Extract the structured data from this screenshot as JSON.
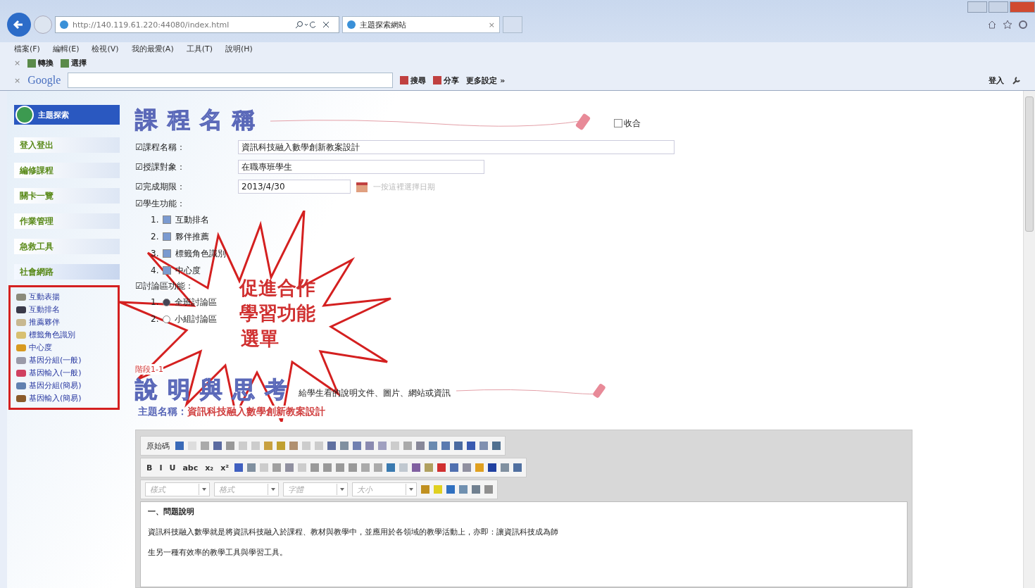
{
  "browser": {
    "address": "http://140.119.61.220:44080/index.html",
    "tabs": [
      {
        "label": "主題探索網站",
        "selected": true,
        "close": "×"
      }
    ],
    "toolbar_close": "×",
    "menu": [
      "檔案(F)",
      "編輯(E)",
      "檢視(V)",
      "我的最愛(A)",
      "工具(T)",
      "說明(H)"
    ],
    "favorites": [
      "轉換",
      "選擇"
    ],
    "google_bar": {
      "logo": "Google",
      "buttons": [
        "搜尋",
        "分享"
      ],
      "more": "更多設定 »",
      "sign_in": "登入"
    }
  },
  "sidebar": {
    "logo": "主題探索",
    "items": [
      {
        "label": "登入登出",
        "expanded": false
      },
      {
        "label": "編修課程",
        "expanded": false
      },
      {
        "label": "關卡一覽",
        "expanded": false
      },
      {
        "label": "作業管理",
        "expanded": false
      },
      {
        "label": "急救工具",
        "expanded": false
      },
      {
        "label": "社會網路",
        "expanded": true
      }
    ],
    "submenu": [
      {
        "label": "互動表揚",
        "color": "#8a8a7a"
      },
      {
        "label": "互動排名",
        "color": "#3a3a4a"
      },
      {
        "label": "推薦夥伴",
        "color": "#c8b890"
      },
      {
        "label": "標籤角色識別",
        "color": "#d8c070"
      },
      {
        "label": "中心度",
        "color": "#d89a20"
      },
      {
        "label": "基因分組(一般)",
        "color": "#9a9aa8"
      },
      {
        "label": "基因輸入(一般)",
        "color": "#d04060"
      },
      {
        "label": "基因分組(簡易)",
        "color": "#6080b0"
      },
      {
        "label": "基因輸入(簡易)",
        "color": "#8a5a2a"
      }
    ]
  },
  "course": {
    "title": "課程名稱",
    "collapse": {
      "label": "收合",
      "checked": false
    },
    "fields": [
      {
        "label": "☑課程名稱：",
        "value": "資訊科技融入數學創新教案設計",
        "kind": "long"
      },
      {
        "label": "☑授課對象：",
        "value": "在職專班學生",
        "kind": "medium"
      },
      {
        "label": "☑完成期限：",
        "value": "2013/4/30",
        "kind": "date",
        "hint": "一按這裡選擇日期"
      }
    ],
    "student_functions": {
      "label": "☑學生功能：",
      "items": [
        {
          "number": "1.",
          "label": "互動排名",
          "checked": true
        },
        {
          "number": "2.",
          "label": "夥伴推薦",
          "checked": true
        },
        {
          "number": "3.",
          "label": "標籤角色識別",
          "checked": true
        },
        {
          "number": "4.",
          "label": "中心度",
          "checked": true
        }
      ]
    },
    "discussion": {
      "label": "☑討論區功能：",
      "items": [
        {
          "number": "1.",
          "label": "全班討論區",
          "selected": true
        },
        {
          "number": "2.",
          "label": "小組討論區",
          "selected": false
        }
      ]
    }
  },
  "callout": [
    "促進合作",
    "學習功能",
    "選單"
  ],
  "stage": {
    "label": "階段1-1",
    "title": "說明與思考",
    "subtitle": "給學生看的說明文件、圖片、網站或資訊",
    "topic_label": "主題名稱：",
    "topic": "資訊科技融入數學創新教案設計"
  },
  "editor": {
    "source_button": "原始碼",
    "format_row": [
      {
        "kind": "glyph",
        "text": "B"
      },
      {
        "kind": "glyph",
        "text": "I"
      },
      {
        "kind": "glyph",
        "text": "U"
      },
      {
        "kind": "glyph",
        "text": "abc"
      },
      {
        "kind": "glyph",
        "text": "x₂"
      },
      {
        "kind": "glyph",
        "text": "x²"
      }
    ],
    "dropdowns": [
      "樣式",
      "格式",
      "字體",
      "大小"
    ],
    "content": [
      {
        "text": "一、問題說明",
        "kind": "heading"
      },
      {
        "text": "資訊科技融入數學就是將資訊科技融入於課程、教材與教學中，並應用於各領域的教學活動上，亦即：讓資訊科技成為師",
        "kind": "para"
      },
      {
        "text": "生另一種有效率的教學工具與學習工具。",
        "kind": "para"
      }
    ]
  }
}
